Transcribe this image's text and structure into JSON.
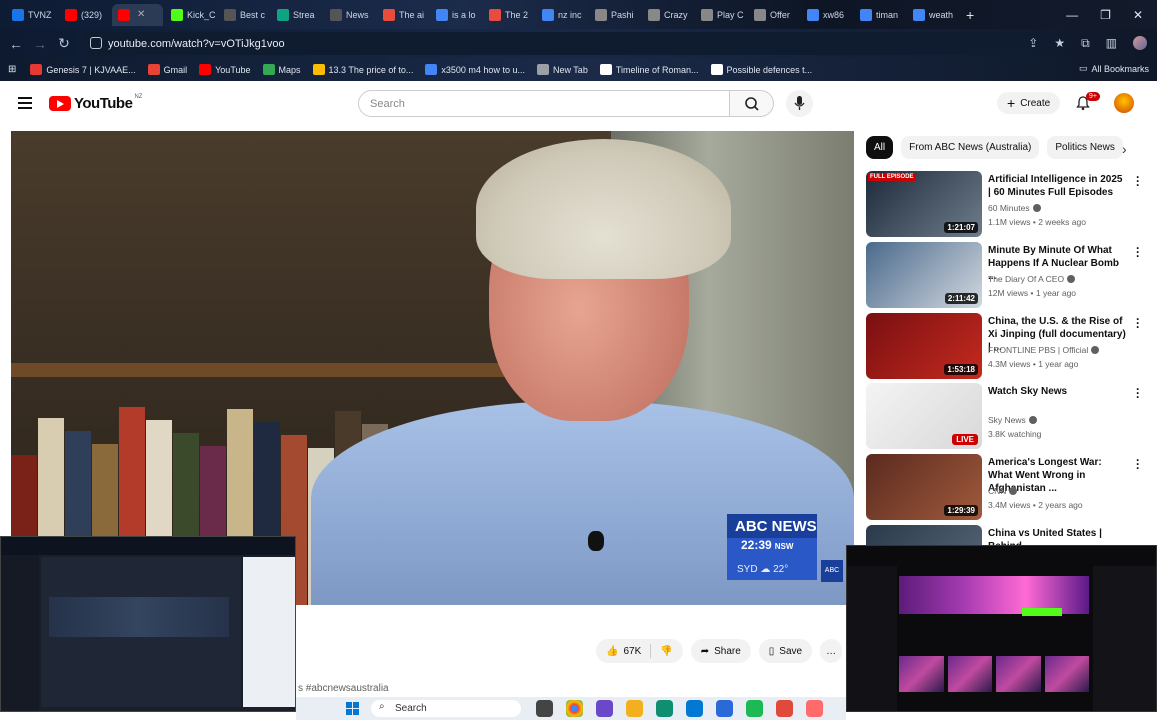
{
  "browser": {
    "tabs": [
      {
        "label": "TVNZ",
        "color": "#1a73e8"
      },
      {
        "label": "(329)",
        "color": "#ff0000"
      },
      {
        "label": "",
        "color": "#ff0000",
        "active": true
      },
      {
        "label": "Kick_C",
        "color": "#53fc18"
      },
      {
        "label": "Best c",
        "color": "#555555"
      },
      {
        "label": "Strea",
        "color": "#10a37f"
      },
      {
        "label": "News",
        "color": "#555555"
      },
      {
        "label": "The ai",
        "color": "#e74c3c"
      },
      {
        "label": "is a lo",
        "color": "#4285f4"
      },
      {
        "label": "The 2",
        "color": "#e74c3c"
      },
      {
        "label": "nz inc",
        "color": "#4285f4"
      },
      {
        "label": "Pashi",
        "color": "#888888"
      },
      {
        "label": "Crazy",
        "color": "#888888"
      },
      {
        "label": "Play C",
        "color": "#888888"
      },
      {
        "label": "Offer",
        "color": "#888888"
      },
      {
        "label": "xw86",
        "color": "#4285f4"
      },
      {
        "label": "timan",
        "color": "#4285f4"
      },
      {
        "label": "weath",
        "color": "#4285f4"
      }
    ],
    "url": "youtube.com/watch?v=vOTiJkg1voo",
    "bookmarks": [
      {
        "label": "Genesis 7 | KJVAAE...",
        "color": "#e53935"
      },
      {
        "label": "Gmail",
        "color": "#ea4335"
      },
      {
        "label": "YouTube",
        "color": "#ff0000"
      },
      {
        "label": "Maps",
        "color": "#34a853"
      },
      {
        "label": "13.3 The price of to...",
        "color": "#fbbc05"
      },
      {
        "label": "x3500 m4 how to u...",
        "color": "#4285f4"
      },
      {
        "label": "New Tab",
        "color": "#9aa0a6"
      },
      {
        "label": "Timeline of Roman...",
        "color": "#ffffff"
      },
      {
        "label": "Possible defences t...",
        "color": "#ffffff"
      }
    ],
    "all_bookmarks": "All Bookmarks"
  },
  "youtube": {
    "logo_text": "YouTube",
    "country": "NZ",
    "search_placeholder": "Search",
    "create_label": "Create",
    "notif_count": "9+",
    "chips": [
      "All",
      "From ABC News (Australia)",
      "Politics News"
    ],
    "video": {
      "abc_brand": "ABC NEWS",
      "abc_time": "22:39",
      "abc_tz": "NSW",
      "abc_temp": "SYD ☁ 22°",
      "abc_mini": "ABC"
    },
    "actions": {
      "likes": "67K",
      "share": "Share",
      "save": "Save"
    },
    "hashtag": "s #abcnewsaustralia",
    "recommendations": [
      {
        "title": "Artificial Intelligence in 2025 | 60 Minutes Full Episodes",
        "channel": "60 Minutes",
        "meta": "1.1M views • 2 weeks ago",
        "duration": "1:21:07",
        "tag": "FULL EPISODE",
        "colors": [
          "#1d2a3a",
          "#6e7d8c"
        ]
      },
      {
        "title": "Minute By Minute Of What Happens If A Nuclear Bomb ...",
        "channel": "The Diary Of A CEO",
        "meta": "12M views • 1 year ago",
        "duration": "2:11:42",
        "tag": "",
        "colors": [
          "#4a6a8c",
          "#d2d8df"
        ]
      },
      {
        "title": "China, the U.S. & the Rise of Xi Jinping (full documentary) | ...",
        "channel": "FRONTLINE PBS | Official",
        "meta": "4.3M views • 1 year ago",
        "duration": "1:53:18",
        "tag": "",
        "colors": [
          "#7a0f12",
          "#c42a1e"
        ]
      },
      {
        "title": "Watch Sky News",
        "channel": "Sky News",
        "meta": "3.8K watching",
        "duration": "LIVE",
        "tag": "",
        "colors": [
          "#f4f4f4",
          "#d8d8d8"
        ]
      },
      {
        "title": "America's Longest War: What Went Wrong in Afghanistan ...",
        "channel": "CNN",
        "meta": "3.4M views • 2 years ago",
        "duration": "1:29:39",
        "tag": "",
        "colors": [
          "#5a2a1f",
          "#a15a3c"
        ]
      },
      {
        "title": "China vs United States | Behind",
        "channel": "",
        "meta": "",
        "duration": "",
        "tag": "",
        "colors": [
          "#2a3a4a",
          "#5a6a7a"
        ]
      }
    ]
  },
  "taskbar": {
    "search_label": "Search"
  }
}
